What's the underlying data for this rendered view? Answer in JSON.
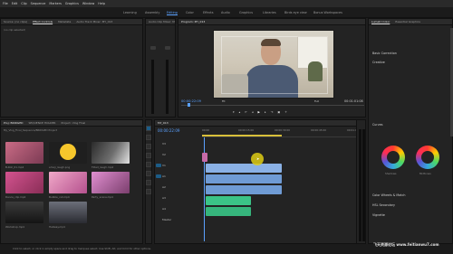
{
  "menu": [
    "File",
    "Edit",
    "Clip",
    "Sequence",
    "Markers",
    "Graphics",
    "Window",
    "Help"
  ],
  "workspaces": [
    "Learning",
    "Assembly",
    "Editing",
    "Color",
    "Effects",
    "Audio",
    "Graphics",
    "Libraries",
    "Birds eye view",
    "Bonus Workspaces"
  ],
  "active_workspace_index": 2,
  "source_panel": {
    "tabs": [
      "Source: (no clips)",
      "Effect Controls",
      "Metadata",
      "Audio Track Mixer: MY_013"
    ],
    "empty_text": "(no clip selected)"
  },
  "mixer_panel": {
    "title": "Audio Clip Mixer: M"
  },
  "program": {
    "title": "Program: MY_013",
    "timecode_left": "00:00:22:09",
    "timecode_right": "00:01:01:08",
    "fit_label": "Fit",
    "quality_label": "Full"
  },
  "project_panel": {
    "tabs": [
      "Proj: BRIDGED",
      "SEQUENCE HOLDER",
      "Project: Vlog Final"
    ],
    "path_text": "My_Vlog_Final_Sequence/BRIDGED Project",
    "items": [
      {
        "name": "B-Roll_01.mp4",
        "duration": "0:08"
      },
      {
        "name": "emoji_laugh.png",
        "duration": "5:00"
      },
      {
        "name": "Tilted_laugh.mp4",
        "duration": "0:12"
      },
      {
        "name": "Dance_clip.mp4",
        "duration": "0:06"
      },
      {
        "name": "Bubble_cut.mp4",
        "duration": "0:04"
      },
      {
        "name": "Party_scene.mp4",
        "duration": "0:05"
      },
      {
        "name": "Workshop.mp4",
        "duration": "0:11"
      },
      {
        "name": "Hallway.mp4",
        "duration": "0:09"
      }
    ]
  },
  "timeline": {
    "title": "MY_013",
    "timecode": "00:00:22:09",
    "ruler": [
      "00:00",
      "00:00:15:00",
      "00:00:30:00",
      "00:00:45:00",
      "00:01:00:00"
    ],
    "tracks": [
      "V3",
      "V2",
      "V1",
      "A1",
      "A2",
      "A3",
      "A4",
      "Master"
    ]
  },
  "lumetri": {
    "tabs": [
      "Lumetri Color",
      "Essential Graphics"
    ],
    "sections": [
      "Basic Correction",
      "Creative",
      "Curves",
      "Color Wheels & Match",
      "HSL Secondary",
      "Vignette"
    ],
    "sub_labels": [
      "Shadows",
      "Midtones",
      "Highlights"
    ]
  },
  "status_text": "Click to select, or click in empty space and drag to marquee select. Use Shift, Alt, and Cmd for other options.",
  "watermark": "飞天资源论坛 www.feitianwu7.com"
}
